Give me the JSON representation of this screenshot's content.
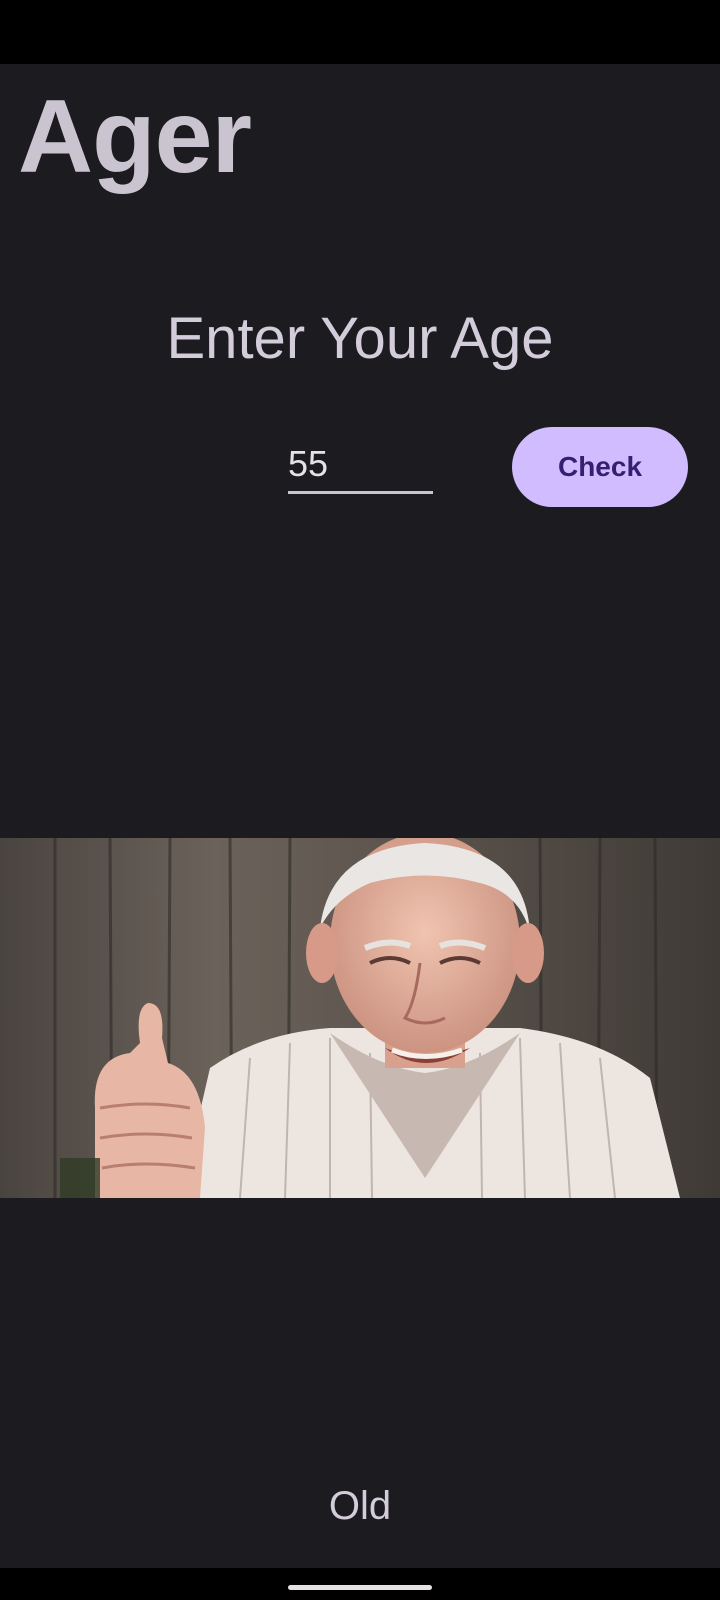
{
  "app": {
    "title": "Ager"
  },
  "form": {
    "prompt": "Enter Your Age",
    "age_value": "55",
    "check_label": "Check"
  },
  "result": {
    "text": "Old"
  },
  "colors": {
    "background": "#1c1b1f",
    "accent": "#d0bcff",
    "button_text": "#381e72",
    "text": "#cac4d0"
  },
  "icons": {
    "photo": "elderly-man-thumbs-up-photo",
    "home": "home-handle"
  }
}
